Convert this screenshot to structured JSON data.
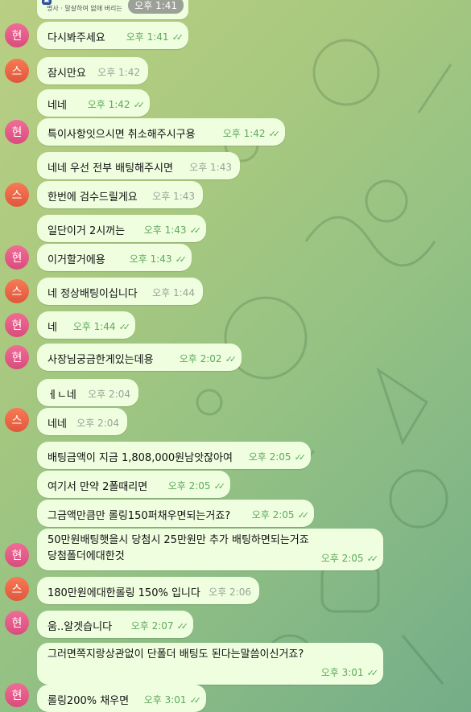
{
  "top_card": {
    "caption": "명사 · 말살하여 없애 버리는",
    "time": "오후 1:41"
  },
  "avatar_labels": {
    "hyun": "현",
    "seu": "스"
  },
  "messages": [
    {
      "text": "다시봐주세요",
      "time": "오후 1:41",
      "read": true
    },
    {
      "text": "잠시만요",
      "time": "오후 1:42",
      "read": false
    },
    {
      "text": "네네",
      "time": "오후 1:42",
      "read": true
    },
    {
      "text": "특이사항잇으시면 취소해주시구용",
      "time": "오후 1:42",
      "read": true
    },
    {
      "text": "네네 우선 전부 배팅해주시면",
      "time": "오후 1:43",
      "read": false
    },
    {
      "text": "한번에 검수드릴게요",
      "time": "오후 1:43",
      "read": false
    },
    {
      "text": "일단이거 2시꺼는",
      "time": "오후 1:43",
      "read": true
    },
    {
      "text": "이거할거에용",
      "time": "오후 1:43",
      "read": true
    },
    {
      "text": "네 정상배팅이십니다",
      "time": "오후 1:44",
      "read": false
    },
    {
      "text": "네",
      "time": "오후 1:44",
      "read": true
    },
    {
      "text": "사장님궁금한게있는데용",
      "time": "오후 2:02",
      "read": true
    },
    {
      "text": "ㅔㄴ네",
      "time": "오후 2:04",
      "read": false
    },
    {
      "text": "네네",
      "time": "오후 2:04",
      "read": false
    },
    {
      "text": "배팅금액이 지금 1,808,000원남앗잖아여",
      "time": "오후 2:05",
      "read": true
    },
    {
      "text": "여기서 만약 2폴때리면",
      "time": "오후 2:05",
      "read": true
    },
    {
      "text": "그금액만큼만 롤링150퍼채우면되는거죠?",
      "time": "오후 2:05",
      "read": true
    },
    {
      "text": "50만원배팅햇을시 당첨시 25만원만 추가 배팅하면되는거죠",
      "text2": "당첨폴더에대한것",
      "time": "오후 2:05",
      "read": true
    },
    {
      "text": "180만원에대한롤링 150% 입니다",
      "time": "오후 2:06",
      "read": false
    },
    {
      "text": "움..알겟습니다",
      "time": "오후 2:07",
      "read": true
    },
    {
      "text": "그러면쪽지랑상관없이 단폴더 배팅도 된다는말씀이신거죠?",
      "time": "오후 3:01",
      "read": true
    },
    {
      "text": "롤링200% 채우면",
      "time": "오후 3:01",
      "read": true
    }
  ]
}
